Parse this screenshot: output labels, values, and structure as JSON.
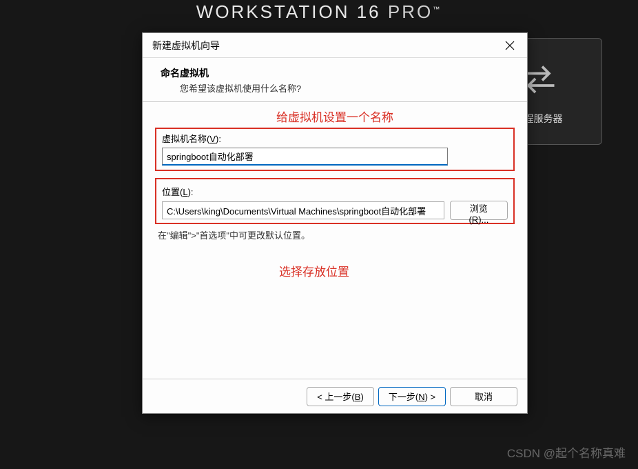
{
  "app": {
    "title_part1": "WORKSTATION 16",
    "title_part2": "PRO",
    "title_tm": "™"
  },
  "side_card": {
    "label": "远程服务器"
  },
  "dialog": {
    "title": "新建虚拟机向导",
    "header_title": "命名虚拟机",
    "header_subtitle": "您希望该虚拟机使用什么名称?",
    "name_label_prefix": "虚拟机名称(",
    "name_label_key": "V",
    "name_label_suffix": "):",
    "name_value": "springboot自动化部署",
    "location_label_prefix": "位置(",
    "location_label_key": "L",
    "location_label_suffix": "):",
    "location_value": "C:\\Users\\king\\Documents\\Virtual Machines\\springboot自动化部署",
    "browse_prefix": "浏览(",
    "browse_key": "R",
    "browse_suffix": ")...",
    "hint": "在\"编辑\">\"首选项\"中可更改默认位置。",
    "back_prefix": "< 上一步(",
    "back_key": "B",
    "back_suffix": ")",
    "next_prefix": "下一步(",
    "next_key": "N",
    "next_suffix": ") >",
    "cancel": "取消"
  },
  "annotations": {
    "top": "给虚拟机设置一个名称",
    "bottom": "选择存放位置"
  },
  "watermark": "CSDN @起个名称真难"
}
